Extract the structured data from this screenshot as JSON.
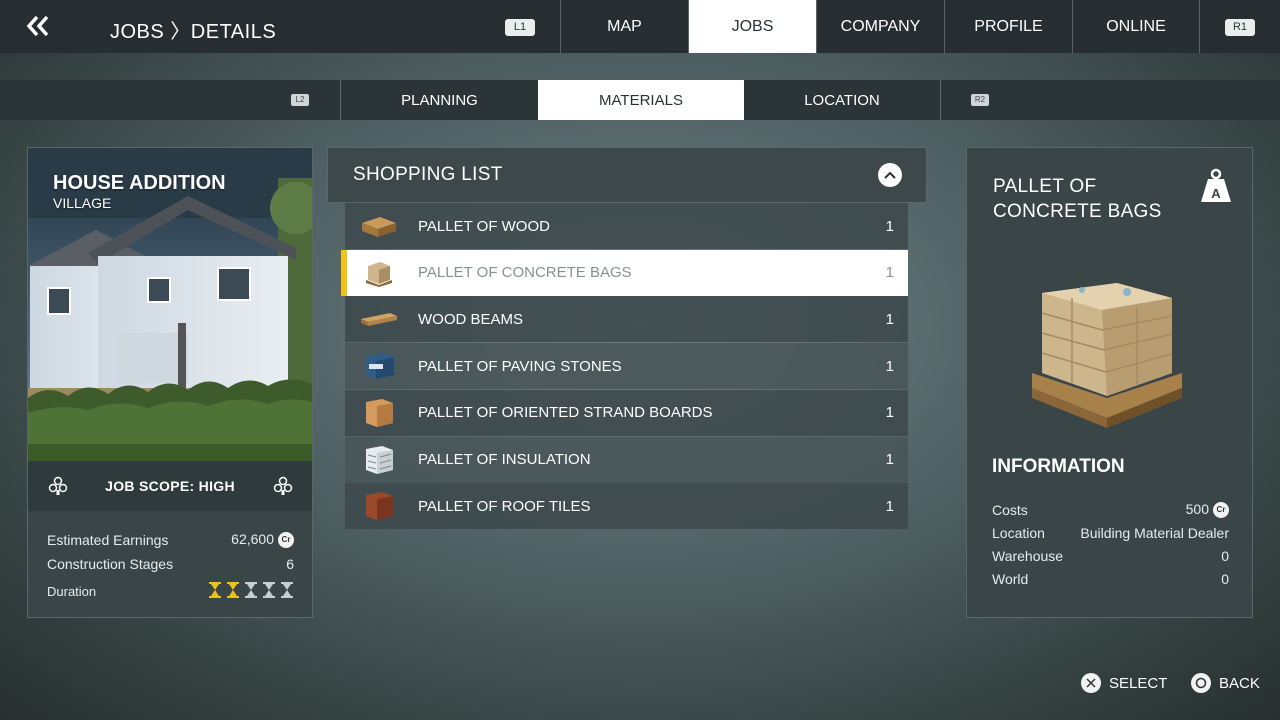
{
  "header": {
    "breadcrumb": "JOBS 〉DETAILS",
    "left_shoulder": "L1",
    "right_shoulder": "R1",
    "tabs": [
      {
        "label": "MAP",
        "active": false
      },
      {
        "label": "JOBS",
        "active": true
      },
      {
        "label": "COMPANY",
        "active": false
      },
      {
        "label": "PROFILE",
        "active": false
      },
      {
        "label": "ONLINE",
        "active": false
      }
    ]
  },
  "subnav": {
    "left_shoulder": "L2",
    "right_shoulder": "R2",
    "tabs": [
      {
        "label": "PLANNING",
        "active": false
      },
      {
        "label": "MATERIALS",
        "active": true
      },
      {
        "label": "LOCATION",
        "active": false
      }
    ]
  },
  "job": {
    "title": "HOUSE ADDITION",
    "subtitle": "VILLAGE",
    "scope": "JOB SCOPE: HIGH",
    "stats": {
      "earnings_label": "Estimated Earnings",
      "earnings_value": "62,600",
      "stages_label": "Construction Stages",
      "stages_value": "6",
      "duration_label": "Duration",
      "duration_filled": 2,
      "duration_total": 5
    },
    "currency_badge": "Cr"
  },
  "shopping_list": {
    "title": "SHOPPING LIST",
    "items": [
      {
        "label": "PALLET OF WOOD",
        "qty": "1",
        "icon": "wood-pallet-icon"
      },
      {
        "label": "PALLET OF CONCRETE BAGS",
        "qty": "1",
        "icon": "concrete-bags-icon",
        "selected": true
      },
      {
        "label": "WOOD BEAMS",
        "qty": "1",
        "icon": "wood-beams-icon"
      },
      {
        "label": "PALLET OF PAVING STONES",
        "qty": "1",
        "icon": "paving-stones-icon"
      },
      {
        "label": "PALLET OF ORIENTED STRAND BOARDS",
        "qty": "1",
        "icon": "osb-pallet-icon"
      },
      {
        "label": "PALLET OF INSULATION",
        "qty": "1",
        "icon": "insulation-pallet-icon"
      },
      {
        "label": "PALLET OF ROOF TILES",
        "qty": "1",
        "icon": "roof-tiles-icon"
      }
    ]
  },
  "detail": {
    "title": "PALLET OF CONCRETE BAGS",
    "weight_class": "A",
    "info_heading": "INFORMATION",
    "rows": [
      {
        "label": "Costs",
        "value": "500"
      },
      {
        "label": "Location",
        "value": "Building Material Dealer"
      },
      {
        "label": "Warehouse",
        "value": "0"
      },
      {
        "label": "World",
        "value": "0"
      }
    ]
  },
  "footer": {
    "select_label": "SELECT",
    "back_label": "BACK"
  },
  "colors": {
    "accent_yellow": "#f2c316",
    "active_tab_bg": "#ffffff"
  }
}
